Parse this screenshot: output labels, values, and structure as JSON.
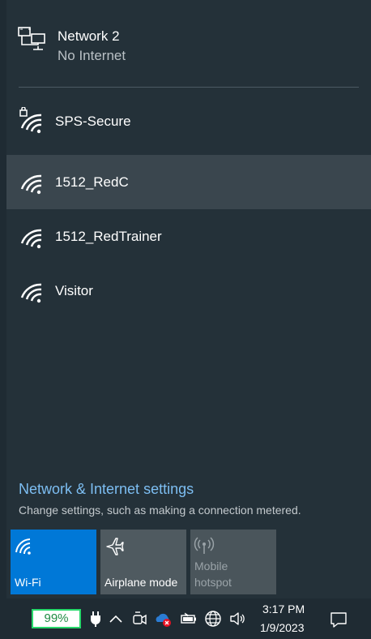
{
  "current_network": {
    "name": "Network 2",
    "status": "No Internet",
    "icon": "wired-ethernet-icon"
  },
  "networks": [
    {
      "name": "SPS-Secure",
      "secured": true,
      "selected": false
    },
    {
      "name": "1512_RedC",
      "secured": false,
      "selected": true
    },
    {
      "name": "1512_RedTrainer",
      "secured": false,
      "selected": false
    },
    {
      "name": "Visitor",
      "secured": false,
      "selected": false
    }
  ],
  "settings": {
    "link_label": "Network & Internet settings",
    "description": "Change settings, such as making a connection metered."
  },
  "quick_actions": [
    {
      "label": "Wi-Fi",
      "active": true,
      "icon": "wifi-icon"
    },
    {
      "label": "Airplane mode",
      "active": false,
      "icon": "airplane-icon"
    },
    {
      "label": "Mobile\nhotspot",
      "active": false,
      "disabled": true,
      "icon": "hotspot-icon"
    }
  ],
  "taskbar": {
    "battery_percent": "99%",
    "time": "3:17 PM",
    "date": "1/9/2023",
    "icons": [
      "power-plug-icon",
      "chevron-up-icon",
      "meet-now-icon",
      "onedrive-error-icon",
      "battery-icon",
      "globe-network-icon",
      "speaker-icon",
      "notifications-icon"
    ]
  },
  "colors": {
    "accent": "#0078d7",
    "link": "#7dbef2",
    "flyout_bg": "#243139",
    "selected_row": "#3a464e",
    "battery_green": "#28d86b"
  }
}
